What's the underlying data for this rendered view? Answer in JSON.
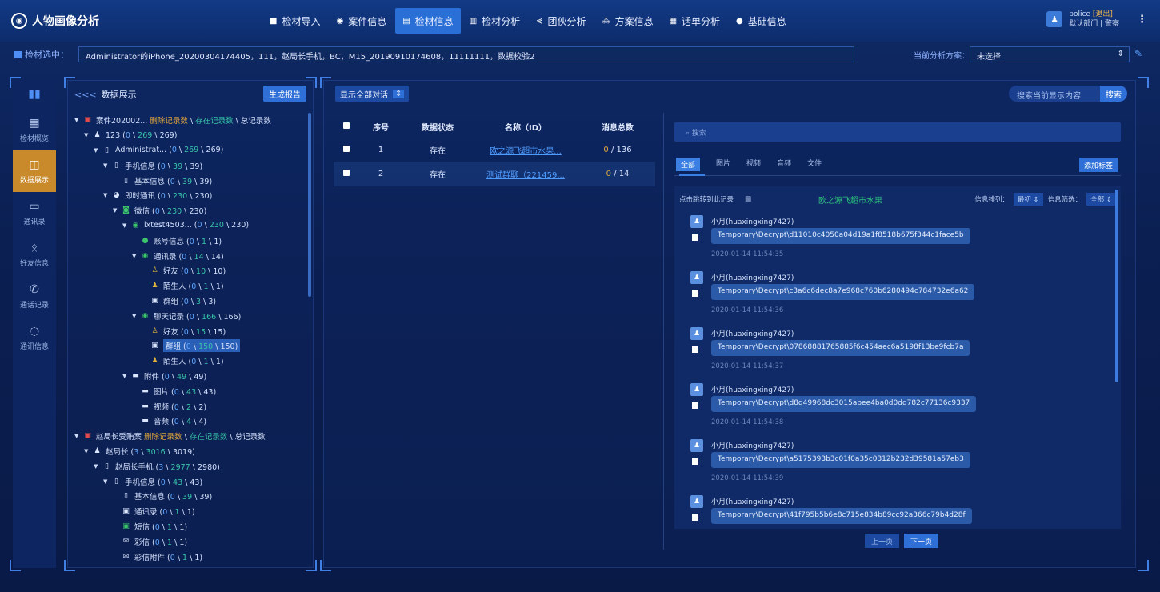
{
  "app": {
    "title": "人物画像分析"
  },
  "nav": [
    {
      "label": "检材导入",
      "icon": "import-icon",
      "glyph": "■"
    },
    {
      "label": "案件信息",
      "icon": "case-icon",
      "glyph": "◉"
    },
    {
      "label": "检材信息",
      "icon": "material-icon",
      "glyph": "▤",
      "active": true
    },
    {
      "label": "检材分析",
      "icon": "analysis-icon",
      "glyph": "▥"
    },
    {
      "label": "团伙分析",
      "icon": "group-icon",
      "glyph": "⋞"
    },
    {
      "label": "方案信息",
      "icon": "plan-icon",
      "glyph": "⁂"
    },
    {
      "label": "话单分析",
      "icon": "call-record-icon",
      "glyph": "▦"
    },
    {
      "label": "基础信息",
      "icon": "basic-info-icon",
      "glyph": "●"
    }
  ],
  "user": {
    "name": "police",
    "logout": "[退出]",
    "dept": "默认部门 | 警察"
  },
  "materials": {
    "label": "检材选中：",
    "value": "Administrator的iPhone_20200304174405，111，赵局长手机，BC，M15_20190910174608，11111111，数据校验2",
    "plan_label": "当前分析方案：",
    "plan_value": "未选择"
  },
  "side": [
    {
      "label": "检材概览",
      "icon": "grid-icon",
      "glyph": "▦"
    },
    {
      "label": "数据展示",
      "icon": "chart-icon",
      "glyph": "◫",
      "active": true
    },
    {
      "label": "通讯录",
      "icon": "contacts-icon",
      "glyph": "▭"
    },
    {
      "label": "好友信息",
      "icon": "friends-icon",
      "glyph": "ᛟ"
    },
    {
      "label": "通话记录",
      "icon": "phone-icon",
      "glyph": "✆"
    },
    {
      "label": "通讯信息",
      "icon": "message-icon",
      "glyph": "◌"
    }
  ],
  "tree_panel": {
    "back": "<<<",
    "title": "数据展示",
    "report_button": "生成报告"
  },
  "tree": [
    {
      "indent": 0,
      "toggle": "▼",
      "icon": "case-icon",
      "glyph": "▣",
      "label": "案件202002...",
      "legend": {
        "a": "删除记录数",
        "b": "存在记录数",
        "c": "总记录数"
      }
    },
    {
      "indent": 1,
      "toggle": "▼",
      "icon": "person-icon",
      "glyph": "♟",
      "label": "123",
      "nums": [
        "0",
        "269",
        "269"
      ]
    },
    {
      "indent": 2,
      "toggle": "▼",
      "icon": "phone-device-icon",
      "glyph": "▯",
      "label": "Administrat...",
      "nums": [
        "0",
        "269",
        "269"
      ]
    },
    {
      "indent": 3,
      "toggle": "▼",
      "icon": "phone-device-icon",
      "glyph": "▯",
      "label": "手机信息",
      "nums": [
        "0",
        "39",
        "39"
      ]
    },
    {
      "indent": 4,
      "toggle": "",
      "icon": "info-icon",
      "glyph": "▯",
      "label": "基本信息",
      "nums": [
        "0",
        "39",
        "39"
      ]
    },
    {
      "indent": 3,
      "toggle": "▼",
      "icon": "chat-icon",
      "glyph": "◕",
      "label": "即时通讯",
      "nums": [
        "0",
        "230",
        "230"
      ]
    },
    {
      "indent": 4,
      "toggle": "▼",
      "icon": "wechat-icon",
      "glyph": "◙",
      "label": "微信",
      "nums": [
        "0",
        "230",
        "230"
      ]
    },
    {
      "indent": 5,
      "toggle": "▼",
      "icon": "wechat-icon",
      "glyph": "◉",
      "label": "lxtest4503...",
      "nums": [
        "0",
        "230",
        "230"
      ]
    },
    {
      "indent": 6,
      "toggle": "",
      "icon": "wechat-icon",
      "glyph": "●",
      "label": "账号信息",
      "nums": [
        "0",
        "1",
        "1"
      ]
    },
    {
      "indent": 6,
      "toggle": "▼",
      "icon": "wechat-icon",
      "glyph": "◉",
      "label": "通讯录",
      "nums": [
        "0",
        "14",
        "14"
      ]
    },
    {
      "indent": 7,
      "toggle": "",
      "icon": "friend-icon",
      "glyph": "♙",
      "label": "好友",
      "nums": [
        "0",
        "10",
        "10"
      ]
    },
    {
      "indent": 7,
      "toggle": "",
      "icon": "stranger-icon",
      "glyph": "♟",
      "label": "陌生人",
      "nums": [
        "0",
        "1",
        "1"
      ]
    },
    {
      "indent": 7,
      "toggle": "",
      "icon": "group-icon",
      "glyph": "▣",
      "label": "群组",
      "nums": [
        "0",
        "3",
        "3"
      ]
    },
    {
      "indent": 6,
      "toggle": "▼",
      "icon": "wechat-icon",
      "glyph": "◉",
      "label": "聊天记录",
      "nums": [
        "0",
        "166",
        "166"
      ]
    },
    {
      "indent": 7,
      "toggle": "",
      "icon": "friend-icon",
      "glyph": "♙",
      "label": "好友",
      "nums": [
        "0",
        "15",
        "15"
      ]
    },
    {
      "indent": 7,
      "toggle": "",
      "icon": "group-icon",
      "glyph": "▣",
      "label": "群组",
      "nums": [
        "0",
        "150",
        "150"
      ],
      "selected": true
    },
    {
      "indent": 7,
      "toggle": "",
      "icon": "stranger-icon",
      "glyph": "♟",
      "label": "陌生人",
      "nums": [
        "0",
        "1",
        "1"
      ]
    },
    {
      "indent": 5,
      "toggle": "▼",
      "icon": "folder-icon",
      "glyph": "▬",
      "label": "附件",
      "nums": [
        "0",
        "49",
        "49"
      ]
    },
    {
      "indent": 6,
      "toggle": "",
      "icon": "image-icon",
      "glyph": "▬",
      "label": "图片",
      "nums": [
        "0",
        "43",
        "43"
      ]
    },
    {
      "indent": 6,
      "toggle": "",
      "icon": "video-icon",
      "glyph": "▬",
      "label": "视频",
      "nums": [
        "0",
        "2",
        "2"
      ]
    },
    {
      "indent": 6,
      "toggle": "",
      "icon": "audio-icon",
      "glyph": "▬",
      "label": "音频",
      "nums": [
        "0",
        "4",
        "4"
      ]
    },
    {
      "indent": 0,
      "toggle": "▼",
      "icon": "case-icon",
      "glyph": "▣",
      "label": "赵局长受贿案",
      "legend": {
        "a": "删除记录数",
        "b": "存在记录数",
        "c": "总记录数"
      }
    },
    {
      "indent": 1,
      "toggle": "▼",
      "icon": "person-icon",
      "glyph": "♟",
      "label": "赵局长",
      "nums": [
        "3",
        "3016",
        "3019"
      ]
    },
    {
      "indent": 2,
      "toggle": "▼",
      "icon": "phone-device-icon",
      "glyph": "▯",
      "label": "赵局长手机",
      "nums": [
        "3",
        "2977",
        "2980"
      ]
    },
    {
      "indent": 3,
      "toggle": "▼",
      "icon": "phone-device-icon",
      "glyph": "▯",
      "label": "手机信息",
      "nums": [
        "0",
        "43",
        "43"
      ]
    },
    {
      "indent": 4,
      "toggle": "",
      "icon": "info-icon",
      "glyph": "▯",
      "label": "基本信息",
      "nums": [
        "0",
        "39",
        "39"
      ]
    },
    {
      "indent": 4,
      "toggle": "",
      "icon": "contacts-icon",
      "glyph": "▣",
      "label": "通讯录",
      "nums": [
        "0",
        "1",
        "1"
      ]
    },
    {
      "indent": 4,
      "toggle": "",
      "icon": "sms-icon",
      "glyph": "▣",
      "label": "短信",
      "nums": [
        "0",
        "1",
        "1"
      ]
    },
    {
      "indent": 4,
      "toggle": "",
      "icon": "mms-icon",
      "glyph": "✉",
      "label": "彩信",
      "nums": [
        "0",
        "1",
        "1"
      ]
    },
    {
      "indent": 4,
      "toggle": "",
      "icon": "mms-attachment-icon",
      "glyph": "✉",
      "label": "彩信附件",
      "nums": [
        "0",
        "1",
        "1"
      ]
    }
  ],
  "main": {
    "filter": "显示全部对话",
    "search_placeholder": "搜索当前显示内容",
    "search_button": "搜索",
    "columns": [
      "序号",
      "数据状态",
      "名称（ID）",
      "消息总数"
    ],
    "rows": [
      {
        "no": "1",
        "status": "存在",
        "name": "欧之源飞超市水果...",
        "deleted": "0",
        "total": "/ 136"
      },
      {
        "no": "2",
        "status": "存在",
        "name": "测试群聊（221459...",
        "deleted": "0",
        "total": "/ 14"
      }
    ]
  },
  "chat": {
    "search_placeholder": "搜索",
    "tabs": [
      "全部",
      "图片",
      "视频",
      "音频",
      "文件"
    ],
    "add_tag": "添加标签",
    "head_left": "点击跳转到此记录",
    "title": "欧之源飞超市水果",
    "sort_label": "信息排列：",
    "sort_value": "最初 ⇕",
    "filter_label": "信息筛选：",
    "filter_value": "全部 ⇕",
    "messages": [
      {
        "who": "小月(huaxingxing7427)",
        "text": "Temporary\\Decrypt\\d11010c4050a04d19a1f8518b675f344c1face5b",
        "time": "2020-01-14 11:54:35"
      },
      {
        "who": "小月(huaxingxing7427)",
        "text": "Temporary\\Decrypt\\c3a6c6dec8a7e968c760b6280494c784732e6a62",
        "time": "2020-01-14 11:54:36"
      },
      {
        "who": "小月(huaxingxing7427)",
        "text": "Temporary\\Decrypt\\07868881765885f6c454aec6a5198f13be9fcb7a",
        "time": "2020-01-14 11:54:37"
      },
      {
        "who": "小月(huaxingxing7427)",
        "text": "Temporary\\Decrypt\\d8d49968dc3015abee4ba0d0dd782c77136c9337",
        "time": "2020-01-14 11:54:38"
      },
      {
        "who": "小月(huaxingxing7427)",
        "text": "Temporary\\Decrypt\\a5175393b3c01f0a35c0312b232d39581a57eb3",
        "time": "2020-01-14 11:54:39"
      },
      {
        "who": "小月(huaxingxing7427)",
        "text": "Temporary\\Decrypt\\41f795b5b6e8c715e834b89cc92a366c79b4d28f",
        "time": ""
      }
    ],
    "prev": "上一页",
    "next": "下一页"
  }
}
